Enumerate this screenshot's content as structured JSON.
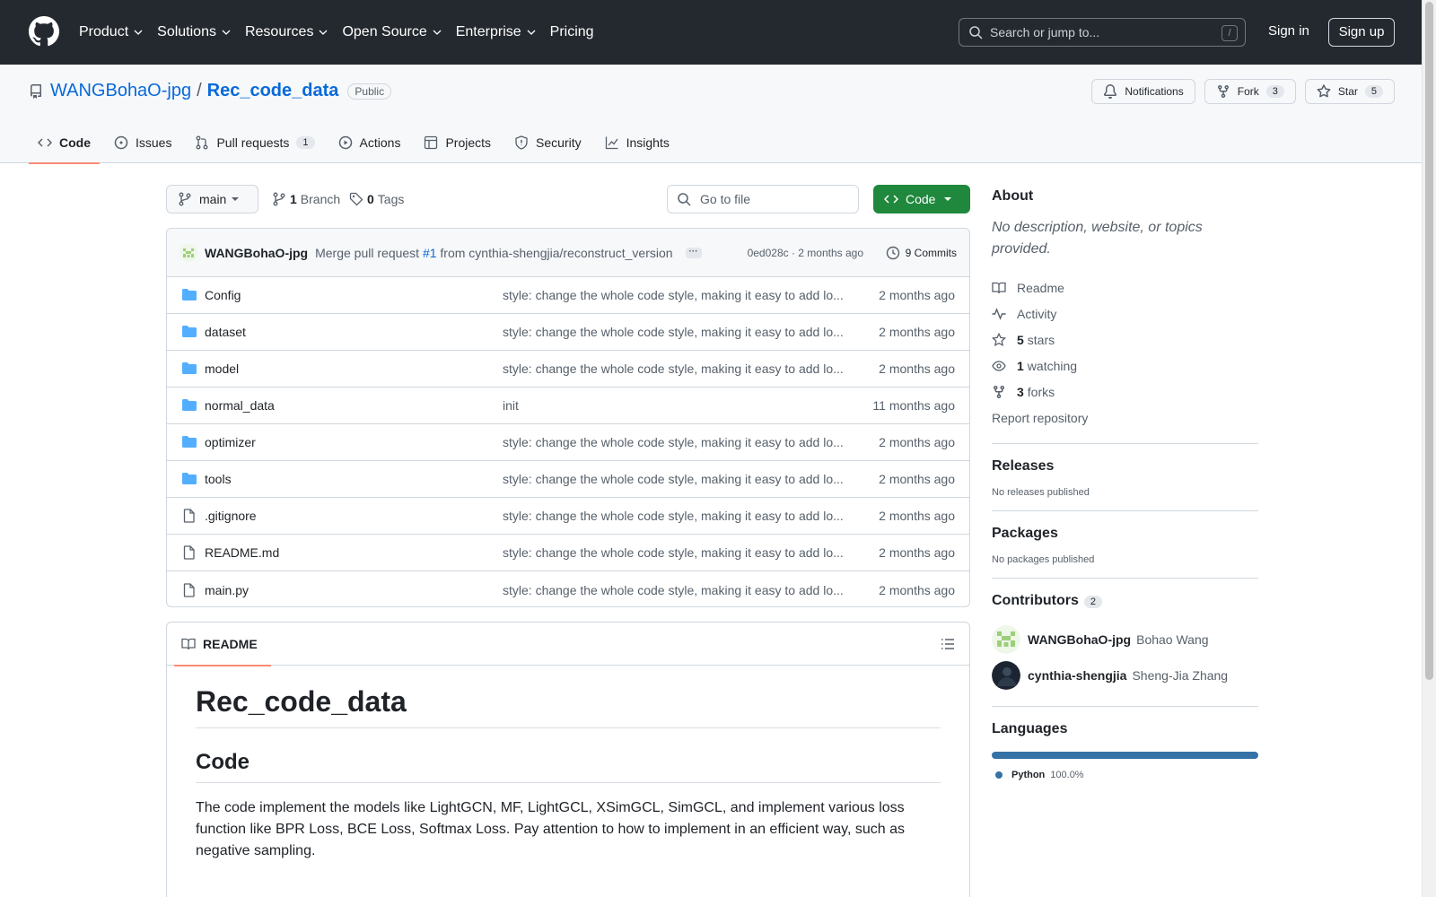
{
  "header": {
    "nav": [
      {
        "label": "Product",
        "dropdown": true
      },
      {
        "label": "Solutions",
        "dropdown": true
      },
      {
        "label": "Resources",
        "dropdown": true
      },
      {
        "label": "Open Source",
        "dropdown": true
      },
      {
        "label": "Enterprise",
        "dropdown": true
      },
      {
        "label": "Pricing",
        "dropdown": false
      }
    ],
    "search_placeholder": "Search or jump to...",
    "search_shortcut": "/",
    "signin": "Sign in",
    "signup": "Sign up"
  },
  "repo": {
    "owner": "WANGBohaO-jpg",
    "separator": "/",
    "name": "Rec_code_data",
    "visibility": "Public",
    "actions": {
      "notifications": "Notifications",
      "fork": "Fork",
      "fork_count": "3",
      "star": "Star",
      "star_count": "5"
    },
    "tabs": [
      {
        "label": "Code",
        "icon": "code-icon",
        "active": true,
        "count": ""
      },
      {
        "label": "Issues",
        "icon": "issue-icon",
        "active": false,
        "count": ""
      },
      {
        "label": "Pull requests",
        "icon": "pull-request-icon",
        "active": false,
        "count": "1"
      },
      {
        "label": "Actions",
        "icon": "play-icon",
        "active": false,
        "count": ""
      },
      {
        "label": "Projects",
        "icon": "table-icon",
        "active": false,
        "count": ""
      },
      {
        "label": "Security",
        "icon": "shield-icon",
        "active": false,
        "count": ""
      },
      {
        "label": "Insights",
        "icon": "graph-icon",
        "active": false,
        "count": ""
      }
    ]
  },
  "toolbar": {
    "branch": "main",
    "branch_count": "1",
    "branch_label": "Branch",
    "tag_count": "0",
    "tag_label": "Tags",
    "goto_placeholder": "Go to file",
    "code_button": "Code"
  },
  "latest_commit": {
    "author": "WANGBohaO-jpg",
    "message_prefix": "Merge pull request",
    "pr": "#1",
    "message_suffix": "from cynthia-shengjia/reconstruct_version",
    "sha_time": "0ed028c · 2 months ago",
    "commits": "9 Commits"
  },
  "files": [
    {
      "name": "Config",
      "type": "dir",
      "message": "style: change the whole code style, making it easy to add lo...",
      "date": "2 months ago"
    },
    {
      "name": "dataset",
      "type": "dir",
      "message": "style: change the whole code style, making it easy to add lo...",
      "date": "2 months ago"
    },
    {
      "name": "model",
      "type": "dir",
      "message": "style: change the whole code style, making it easy to add lo...",
      "date": "2 months ago"
    },
    {
      "name": "normal_data",
      "type": "dir",
      "message": "init",
      "date": "11 months ago"
    },
    {
      "name": "optimizer",
      "type": "dir",
      "message": "style: change the whole code style, making it easy to add lo...",
      "date": "2 months ago"
    },
    {
      "name": "tools",
      "type": "dir",
      "message": "style: change the whole code style, making it easy to add lo...",
      "date": "2 months ago"
    },
    {
      "name": ".gitignore",
      "type": "file",
      "message": "style: change the whole code style, making it easy to add lo...",
      "date": "2 months ago"
    },
    {
      "name": "README.md",
      "type": "file",
      "message": "style: change the whole code style, making it easy to add lo...",
      "date": "2 months ago"
    },
    {
      "name": "main.py",
      "type": "file",
      "message": "style: change the whole code style, making it easy to add lo...",
      "date": "2 months ago"
    }
  ],
  "readme": {
    "tab": "README",
    "h1": "Rec_code_data",
    "h2": "Code",
    "paragraph": "The code implement the models like LightGCN, MF, LightGCL, XSimGCL, SimGCL, and implement various loss function like BPR Loss, BCE Loss, Softmax Loss. Pay attention to how to implement in an efficient way, such as negative sampling."
  },
  "sidebar": {
    "about_title": "About",
    "about_desc": "No description, website, or topics provided.",
    "readme": "Readme",
    "activity": "Activity",
    "stars_count": "5",
    "stars_label": "stars",
    "watching_count": "1",
    "watching_label": "watching",
    "forks_count": "3",
    "forks_label": "forks",
    "report": "Report repository",
    "releases_title": "Releases",
    "releases_desc": "No releases published",
    "packages_title": "Packages",
    "packages_desc": "No packages published",
    "contributors_title": "Contributors",
    "contributors_count": "2",
    "contributors": [
      {
        "login": "WANGBohaO-jpg",
        "name": "Bohao Wang"
      },
      {
        "login": "cynthia-shengjia",
        "name": "Sheng-Jia Zhang"
      }
    ],
    "languages_title": "Languages",
    "language": "Python",
    "language_pct": "100.0%",
    "language_color": "#3572A5"
  },
  "colors": {
    "header_bg": "#24292f",
    "link": "#0969da",
    "primary_button": "#1f883d",
    "active_tab_underline": "#fd8c73",
    "folder": "#54aeff"
  }
}
